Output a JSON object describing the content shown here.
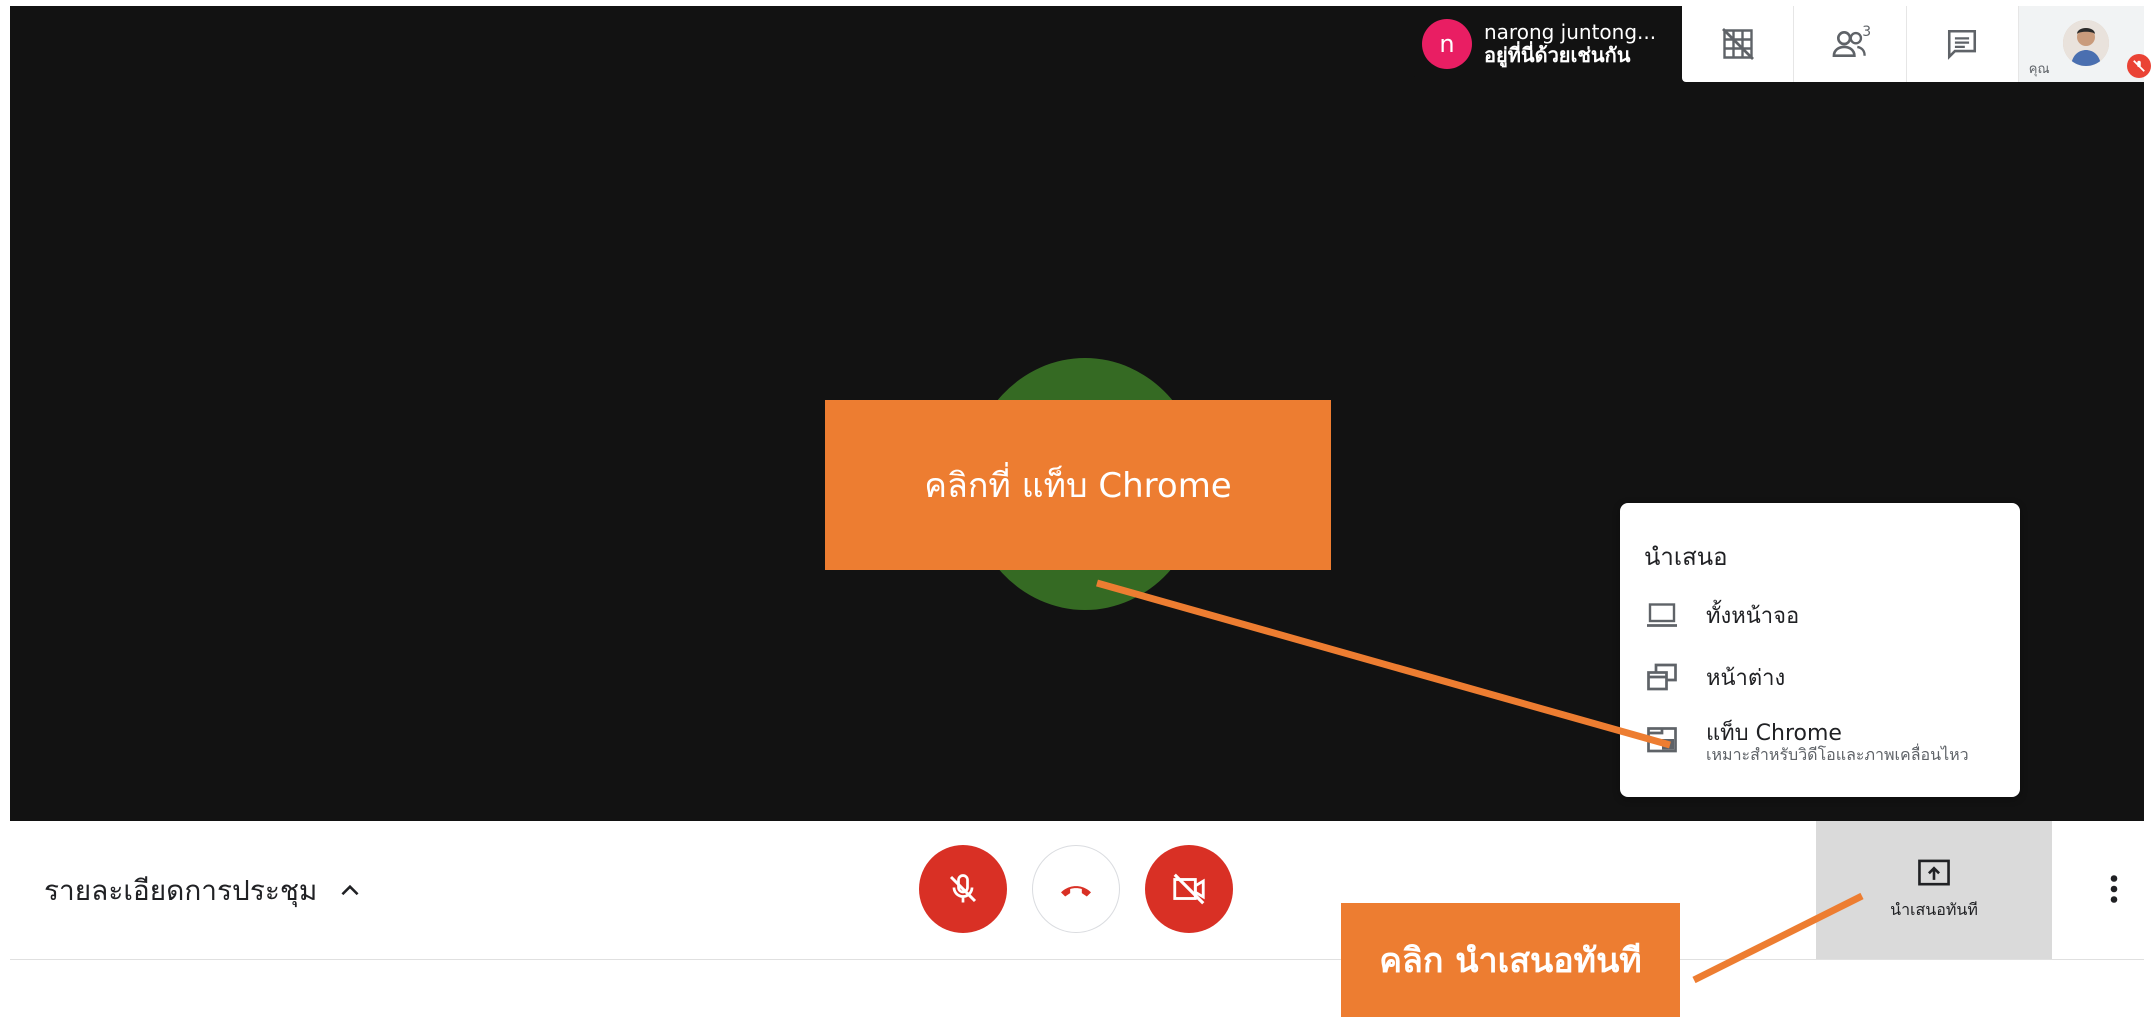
{
  "participant": {
    "initial": "n",
    "name": "narong juntong...",
    "status": "อยู่ที่นี่ด้วยเช่นกัน"
  },
  "top_bar": {
    "people_count": "3",
    "self_label": "คุณ"
  },
  "present_menu": {
    "title": "นำเสนอ",
    "items": [
      {
        "label": "ทั้งหน้าจอ",
        "icon": "laptop-icon"
      },
      {
        "label": "หน้าต่าง",
        "icon": "window-icon"
      },
      {
        "label": "แท็บ Chrome",
        "sublabel": "เหมาะสำหรับวิดีโอและภาพเคลื่อนไหว",
        "icon": "tab-icon"
      }
    ]
  },
  "bottom_bar": {
    "meeting_details": "รายละเอียดการประชุม",
    "present_now": "นำเสนอทันที"
  },
  "annotations": {
    "callout_tab": "คลิกที่ แท็บ Chrome",
    "callout_present": "คลิก นำเสนอทันที"
  },
  "colors": {
    "stage_bg": "#121212",
    "avatar_green": "#356a23",
    "red_button": "#d93025",
    "callout_orange": "#ed7d31",
    "participant_pink": "#e91e63"
  }
}
